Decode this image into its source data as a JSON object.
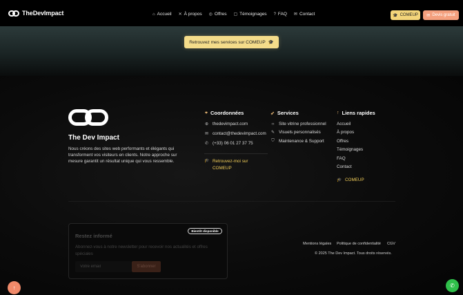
{
  "header": {
    "brand": "TheDevImpact",
    "nav": [
      {
        "label": "Accueil",
        "icon": "⌂"
      },
      {
        "label": "À propos",
        "icon": "✕"
      },
      {
        "label": "Offres",
        "icon": "◎"
      },
      {
        "label": "Témoignages",
        "icon": "▢"
      },
      {
        "label": "FAQ",
        "icon": "?"
      },
      {
        "label": "Contact",
        "icon": "✉"
      }
    ],
    "comeup_label": "COMEUP",
    "devis_label": "Devis gratuit"
  },
  "hero": {
    "cta_label": "Retrouvez mes services sur COMEUP"
  },
  "footer": {
    "brand_name": "The Dev Impact",
    "description": "Nous créons des sites web performants et élégants qui transforment vos visiteurs en clients. Notre approche sur mesure garantit un résultat unique qui vous ressemble.",
    "coordonnees": {
      "title": "Coordonnées",
      "website": "thedevimpact.com",
      "email": "contact@thedevimpact.com",
      "phone": "(+33) 06 01 27 37 75",
      "comeup_link": "Retrouvez-moi sur COMEUP"
    },
    "services": {
      "title": "Services",
      "items": [
        "Site vitrine professionnel",
        "Visuels personnalisés",
        "Maintenance & Support"
      ]
    },
    "liens": {
      "title": "Liens rapides",
      "items": [
        "Accueil",
        "À propos",
        "Offres",
        "Témoignages",
        "FAQ",
        "Contact"
      ],
      "comeup": "COMEUP"
    },
    "newsletter": {
      "badge": "Bientôt disponible",
      "title": "Restez informé",
      "text": "Abonnez-vous à notre newsletter pour recevoir nos actualités et offres spéciales",
      "placeholder": "Votre email",
      "button": "S'abonner"
    },
    "legal": [
      "Mentions légales",
      "Politique de confidentialité",
      "CGV"
    ],
    "copyright": "© 2025 The Dev Impact. Tous droits réservés."
  },
  "colors": {
    "comeup": "#f3d57a",
    "devis": "#f4a07e",
    "whatsapp": "#2fbf4a",
    "scroll_top": "#f08a6a"
  }
}
